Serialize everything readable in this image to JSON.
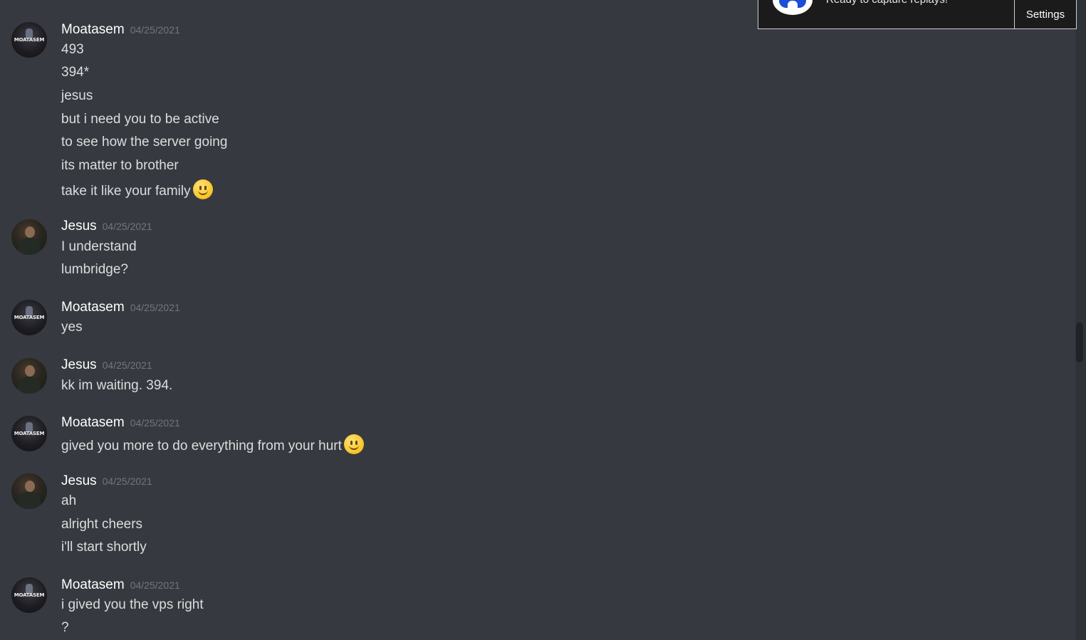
{
  "notification": {
    "text": "Ready to capture replays!",
    "settings_label": "Settings"
  },
  "messages": [
    {
      "author": "Moatasem",
      "timestamp": "04/25/2021",
      "avatar_text": "MOATASEM",
      "lines": [
        "493",
        "394*",
        "jesus",
        "but i need you to be active",
        "to see how the server going",
        "its matter to brother",
        "take it like your family"
      ]
    },
    {
      "author": "Jesus",
      "timestamp": "04/25/2021",
      "lines": [
        "I understand",
        "lumbridge?"
      ]
    },
    {
      "author": "Moatasem",
      "timestamp": "04/25/2021",
      "avatar_text": "MOATASEM",
      "lines": [
        "yes"
      ]
    },
    {
      "author": "Jesus",
      "timestamp": "04/25/2021",
      "lines": [
        "kk im waiting. 394."
      ]
    },
    {
      "author": "Moatasem",
      "timestamp": "04/25/2021",
      "avatar_text": "MOATASEM",
      "lines": [
        "gived you more to do everything from your hurt"
      ]
    },
    {
      "author": "Jesus",
      "timestamp": "04/25/2021",
      "lines": [
        "ah",
        "alright cheers",
        "i'll start shortly"
      ]
    },
    {
      "author": "Moatasem",
      "timestamp": "04/25/2021",
      "avatar_text": "MOATASEM",
      "lines": [
        "i gived you the vps right",
        "?"
      ]
    }
  ],
  "emojis": {
    "smile": "slightly-smiling-face"
  }
}
